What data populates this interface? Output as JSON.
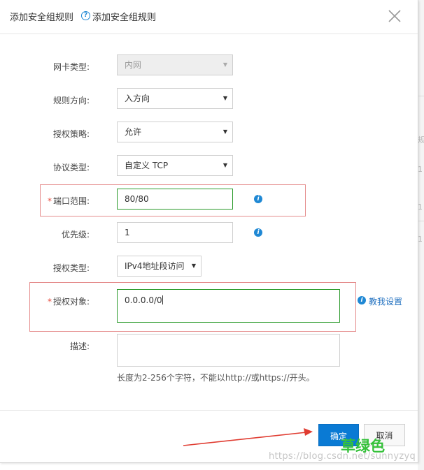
{
  "dialog": {
    "title": "添加安全组规则",
    "subtitle": "添加安全组规则",
    "close_icon": "close-icon",
    "help_icon": "question-circle-icon"
  },
  "form": {
    "nic_type": {
      "label": "网卡类型:",
      "value": "内网",
      "disabled": true
    },
    "direction": {
      "label": "规则方向:",
      "value": "入方向"
    },
    "policy": {
      "label": "授权策略:",
      "value": "允许"
    },
    "protocol": {
      "label": "协议类型:",
      "value": "自定义 TCP"
    },
    "port_range": {
      "required_mark": "*",
      "label": "端口范围:",
      "value": "80/80"
    },
    "priority": {
      "label": "优先级:",
      "value": "1"
    },
    "auth_type": {
      "label": "授权类型:",
      "value": "IPv4地址段访问"
    },
    "auth_object": {
      "required_mark": "*",
      "label": "授权对象:",
      "value": "0.0.0.0/0",
      "help_link": "教我设置"
    },
    "description": {
      "label": "描述:",
      "value": "",
      "hint": "长度为2-256个字符，不能以http://或https://开头。"
    }
  },
  "footer": {
    "ok_label": "确定",
    "cancel_label": "取消"
  },
  "annotations": {
    "overlay_text": "草绿色",
    "watermark": "https://blog.csdn.net/sunnyzyq",
    "highlight_color": "#e58c8c",
    "overlay_color": "#35c13a",
    "arrow_color": "#e03c31"
  },
  "colors": {
    "primary": "#0a7ad4",
    "link": "#1f6fbf",
    "valid_border": "#2b9a2b",
    "required": "#e74c3c"
  },
  "background_fragments": [
    "规",
    "1",
    "1",
    "1"
  ]
}
